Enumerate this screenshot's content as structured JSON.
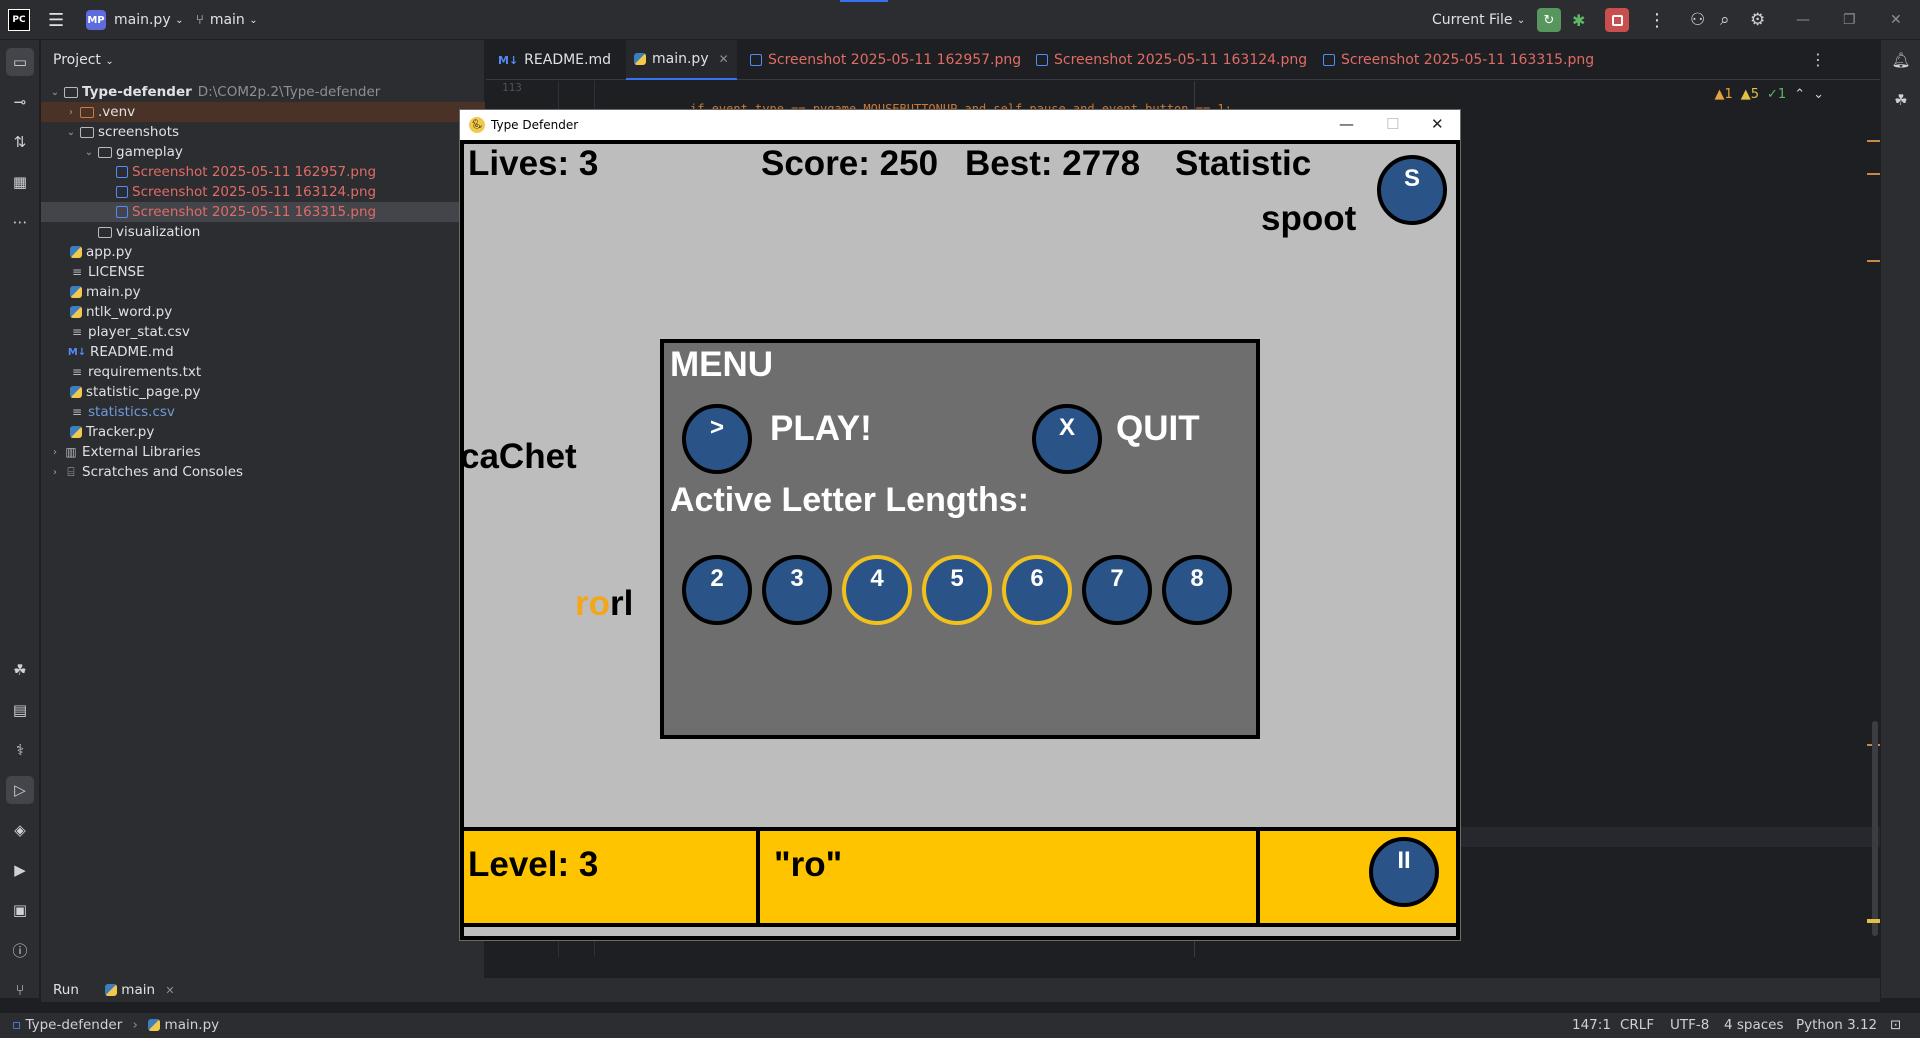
{
  "titlebar": {
    "logo": "PC",
    "project_badge": "MP",
    "project_name": "main.py",
    "branch": "main",
    "run_config": "Current File"
  },
  "project_panel": {
    "header": "Project",
    "root_name": "Type-defender",
    "root_path": "D:\\COM2p.2\\Type-defender",
    "items": {
      "venv": ".venv",
      "screenshots": "screenshots",
      "gameplay": "gameplay",
      "shot1": "Screenshot 2025-05-11 162957.png",
      "shot2": "Screenshot 2025-05-11 163124.png",
      "shot3": "Screenshot 2025-05-11 163315.png",
      "visualization": "visualization",
      "app": "app.py",
      "license": "LICENSE",
      "main": "main.py",
      "ntlk": "ntlk_word.py",
      "player_stat": "player_stat.csv",
      "readme": "README.md",
      "requirements": "requirements.txt",
      "statistic_page": "statistic_page.py",
      "statistics": "statistics.csv",
      "tracker": "Tracker.py",
      "external": "External Libraries",
      "scratches": "Scratches and Consoles"
    }
  },
  "tabs": [
    {
      "label": "README.md",
      "icon": "M↓"
    },
    {
      "label": "main.py",
      "icon": "py"
    },
    {
      "label": "Screenshot 2025-05-11 162957.png",
      "icon": "img"
    },
    {
      "label": "Screenshot 2025-05-11 163124.png",
      "icon": "img"
    },
    {
      "label": "Screenshot 2025-05-11 163315.png",
      "icon": "img"
    }
  ],
  "editor": {
    "line_number": "113",
    "code": "if event.type == pygame.MOUSEBUTTONUP and self.pause and event.button == 1:",
    "inspections": {
      "errors": "1",
      "warnings": "5",
      "ok": "1"
    }
  },
  "game": {
    "window_title": "Type Defender",
    "lives": "Lives: 3",
    "score": "Score: 250",
    "best": "Best: 2778",
    "statistic": "Statistic",
    "stat_button": "S",
    "word_top": "spoot",
    "word_left": "caChet",
    "word_typed": "ro",
    "word_rest": "rl",
    "menu": {
      "title": "MENU",
      "play_symbol": ">",
      "play_label": "PLAY!",
      "quit_symbol": "X",
      "quit_label": "QUIT",
      "lengths_label": "Active Letter Lengths:",
      "lengths": [
        {
          "value": "2",
          "active": false
        },
        {
          "value": "3",
          "active": false
        },
        {
          "value": "4",
          "active": true
        },
        {
          "value": "5",
          "active": true
        },
        {
          "value": "6",
          "active": true
        },
        {
          "value": "7",
          "active": false
        },
        {
          "value": "8",
          "active": false
        }
      ]
    },
    "level": "Level: 3",
    "typed_buffer": "\"ro\"",
    "pause_symbol": "II"
  },
  "runbar": {
    "label": "Run",
    "config": "main"
  },
  "statusbar": {
    "crumb_project": "Type-defender",
    "crumb_file": "main.py",
    "position": "147:1",
    "line_sep": "CRLF",
    "encoding": "UTF-8",
    "indent": "4 spaces",
    "interpreter": "Python 3.12"
  },
  "colors": {
    "accent": "#3574f0",
    "game_bg": "#bdbdbd",
    "hud_yellow": "#ffc400",
    "circle_blue": "#2a5488",
    "active_ring": "#f2c01a"
  }
}
